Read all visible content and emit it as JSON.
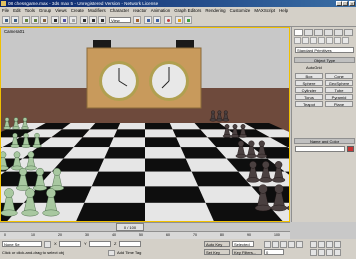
{
  "window": {
    "title": "08 chessgame.max - 3ds max 5 - Unregistered Version - Network License",
    "minimize": "_",
    "maximize": "□",
    "close": "×"
  },
  "menu": [
    "File",
    "Edit",
    "Tools",
    "Group",
    "Views",
    "Create",
    "Modifiers",
    "Character",
    "reactor",
    "Animation",
    "Graph Editors",
    "Rendering",
    "Customize",
    "MAXScript",
    "Help"
  ],
  "toolbar": {
    "view_combo": "View"
  },
  "viewport": {
    "label": "Camera01"
  },
  "panel": {
    "category_dropdown": "Standard Primitives",
    "object_type_header": "Object Type",
    "autogrid": "AutoGrid",
    "objects": [
      "Box",
      "Cone",
      "Sphere",
      "GeoSphere",
      "Cylinder",
      "Tube",
      "Torus",
      "Pyramid",
      "Teapot",
      "Plane"
    ],
    "name_color_header": "Name and Color",
    "swatch_color": "#c83232"
  },
  "timeline": {
    "slider_label": "0 / 100",
    "ruler_ticks": [
      "0",
      "10",
      "20",
      "30",
      "40",
      "50",
      "60",
      "70",
      "80",
      "90",
      "100"
    ]
  },
  "status": {
    "selection_none": "None Se",
    "prompt": "Click or click-and-drag to select obj",
    "add_time_tag": "Add Time Tag",
    "x_label": "X",
    "y_label": "Y",
    "z_label": "Z",
    "auto_key": "Auto Key",
    "set_key": "Set Key",
    "selected_option": "Selected",
    "key_filters": "Key Filters...",
    "frame": "0"
  },
  "colors": {
    "title_bar": "#0a246a",
    "viewport_border": "#f0c000",
    "wall": "#6e4a3c",
    "board_dark": "#0e0e0e",
    "board_light": "#e6e6e6",
    "clock_case": "#c89a5c"
  }
}
